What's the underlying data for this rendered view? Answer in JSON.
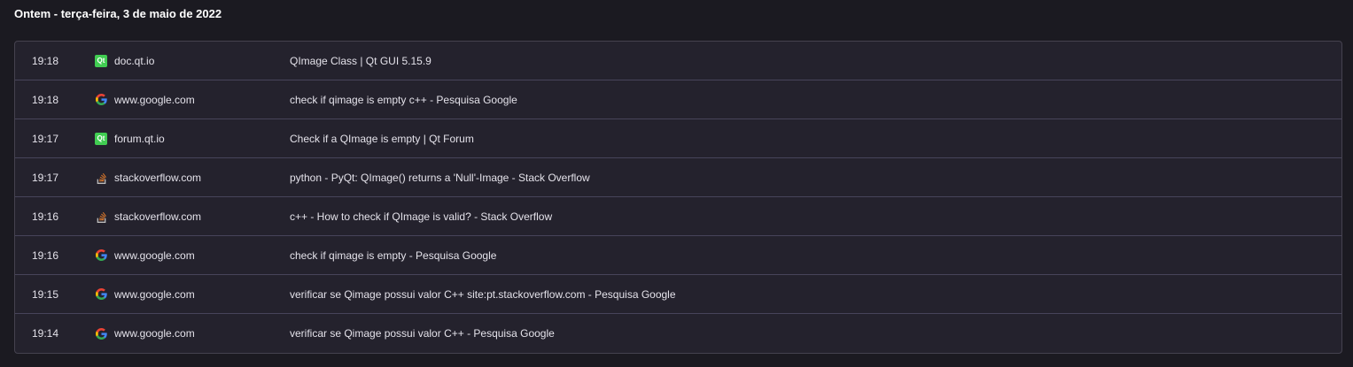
{
  "day_heading": "Ontem - terça-feira, 3 de maio de 2022",
  "entries": [
    {
      "time": "19:18",
      "icon": "qt-icon",
      "domain": "doc.qt.io",
      "title": "QImage Class | Qt GUI 5.15.9"
    },
    {
      "time": "19:18",
      "icon": "google-icon",
      "domain": "www.google.com",
      "title": "check if qimage is empty c++ - Pesquisa Google"
    },
    {
      "time": "19:17",
      "icon": "qt-icon",
      "domain": "forum.qt.io",
      "title": "Check if a QImage is empty | Qt Forum"
    },
    {
      "time": "19:17",
      "icon": "stackoverflow-icon",
      "domain": "stackoverflow.com",
      "title": "python - PyQt: QImage() returns a 'Null'-Image - Stack Overflow"
    },
    {
      "time": "19:16",
      "icon": "stackoverflow-icon",
      "domain": "stackoverflow.com",
      "title": "c++ - How to check if QImage is valid? - Stack Overflow"
    },
    {
      "time": "19:16",
      "icon": "google-icon",
      "domain": "www.google.com",
      "title": "check if qimage is empty - Pesquisa Google"
    },
    {
      "time": "19:15",
      "icon": "google-icon",
      "domain": "www.google.com",
      "title": "verificar se Qimage possui valor C++ site:pt.stackoverflow.com - Pesquisa Google"
    },
    {
      "time": "19:14",
      "icon": "google-icon",
      "domain": "www.google.com",
      "title": "verificar se Qimage possui valor C++ - Pesquisa Google"
    }
  ],
  "qt_icon_text": "Qt",
  "colors": {
    "background": "#1b1a21",
    "card": "#24222d",
    "divider": "#47445a",
    "qt_green": "#41cd52",
    "so_orange": "#bc6a2c"
  }
}
